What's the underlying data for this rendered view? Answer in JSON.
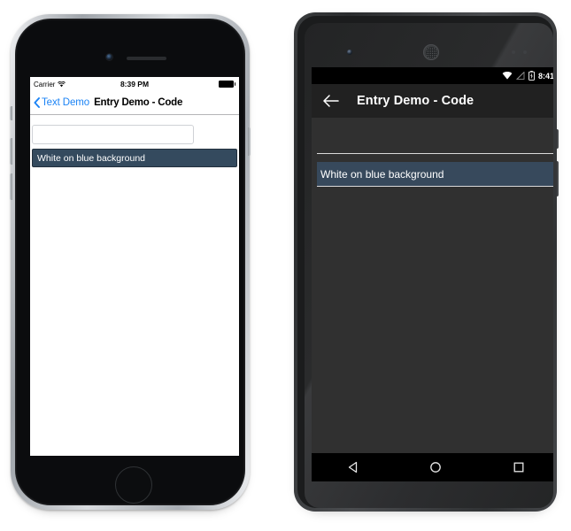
{
  "ios": {
    "device_name": "iphone-device",
    "statusbar": {
      "carrier": "Carrier",
      "wifi_icon": "wifi-icon",
      "time": "8:39 PM",
      "battery_icon": "battery-full-icon"
    },
    "navbar": {
      "back_icon": "chevron-left-icon",
      "back_label": "Text Demo",
      "title": "Entry Demo - Code"
    },
    "content": {
      "plain_entry": {
        "name": "plain-entry",
        "value": "",
        "placeholder": ""
      },
      "blue_entry": {
        "name": "white-on-blue-entry",
        "value": "White on blue background",
        "background_color": "#344a5e",
        "text_color": "#ffffff"
      }
    }
  },
  "android": {
    "device_name": "android-device",
    "statusbar": {
      "wifi_icon": "wifi-icon",
      "signal_icon": "signal-no-service-icon",
      "battery_icon": "battery-charging-icon",
      "time": "8:41"
    },
    "toolbar": {
      "back_icon": "arrow-left-icon",
      "title": "Entry Demo - Code"
    },
    "content": {
      "plain_entry": {
        "name": "plain-entry",
        "value": "",
        "placeholder": ""
      },
      "blue_entry": {
        "name": "white-on-blue-entry",
        "value": "White on blue background",
        "background_color": "#37495c",
        "text_color": "#ffffff"
      }
    },
    "navbar": {
      "back_icon": "nav-back-triangle-icon",
      "home_icon": "nav-home-circle-icon",
      "recents_icon": "nav-recents-square-icon"
    }
  },
  "colors": {
    "ios_accent": "#1b83f5",
    "ios_navbar_bg": "#ffffff",
    "android_toolbar_bg": "#212121",
    "android_content_bg": "#303030",
    "entry_blue_ios": "#344a5e",
    "entry_blue_android": "#37495c"
  }
}
